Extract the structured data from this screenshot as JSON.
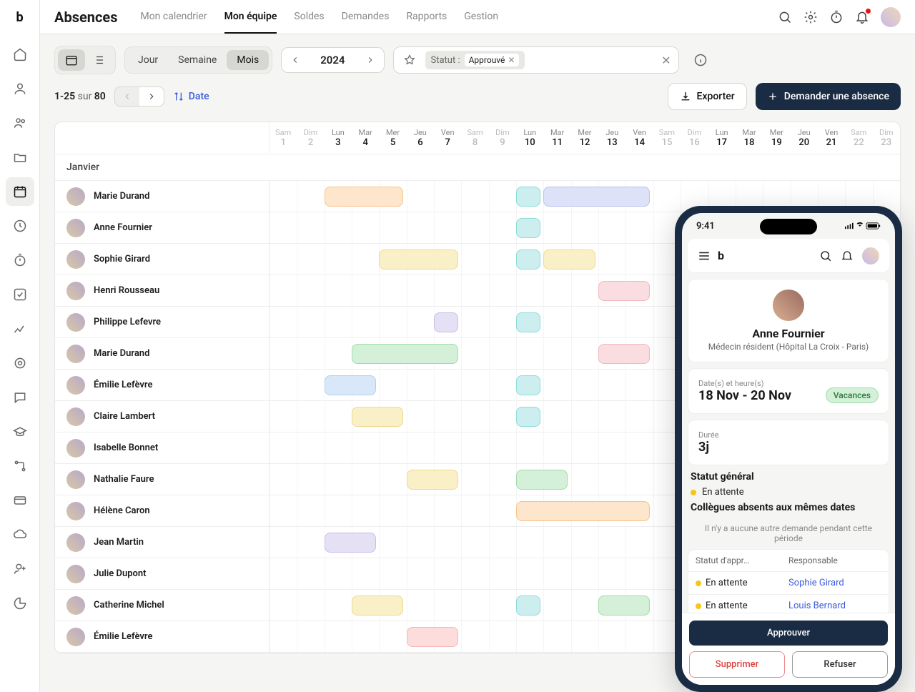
{
  "header": {
    "title": "Absences",
    "tabs": [
      "Mon calendrier",
      "Mon équipe",
      "Soldes",
      "Demandes",
      "Rapports",
      "Gestion"
    ],
    "active_tab": 1
  },
  "toolbar": {
    "view_modes": [
      "Jour",
      "Semaine",
      "Mois"
    ],
    "active_view": 2,
    "year": "2024",
    "filter_label": "Statut :",
    "filter_value": "Approuvé"
  },
  "subbar": {
    "range_from": "1-25",
    "range_of": "sur",
    "range_total": "80",
    "sort_label": "Date",
    "export_label": "Exporter",
    "request_label": "Demander une absence"
  },
  "calendar": {
    "month_label": "Janvier",
    "days": [
      {
        "dow": "Sam",
        "num": "1",
        "weekend": true
      },
      {
        "dow": "Dim",
        "num": "2",
        "weekend": true
      },
      {
        "dow": "Lun",
        "num": "3"
      },
      {
        "dow": "Mar",
        "num": "4"
      },
      {
        "dow": "Mer",
        "num": "5"
      },
      {
        "dow": "Jeu",
        "num": "6"
      },
      {
        "dow": "Ven",
        "num": "7"
      },
      {
        "dow": "Sam",
        "num": "8",
        "weekend": true
      },
      {
        "dow": "Dim",
        "num": "9",
        "weekend": true
      },
      {
        "dow": "Lun",
        "num": "10"
      },
      {
        "dow": "Mar",
        "num": "11"
      },
      {
        "dow": "Mer",
        "num": "12"
      },
      {
        "dow": "Jeu",
        "num": "13"
      },
      {
        "dow": "Ven",
        "num": "14"
      },
      {
        "dow": "Sam",
        "num": "15",
        "weekend": true
      },
      {
        "dow": "Dim",
        "num": "16",
        "weekend": true
      },
      {
        "dow": "Lun",
        "num": "17"
      },
      {
        "dow": "Mar",
        "num": "18"
      },
      {
        "dow": "Mer",
        "num": "19"
      },
      {
        "dow": "Jeu",
        "num": "20"
      },
      {
        "dow": "Ven",
        "num": "21"
      },
      {
        "dow": "Sam",
        "num": "22",
        "weekend": true
      },
      {
        "dow": "Dim",
        "num": "23",
        "weekend": true
      }
    ],
    "rows": [
      {
        "name": "Marie Durand",
        "bars": [
          {
            "start": 2,
            "span": 3,
            "color": "c-orange"
          },
          {
            "start": 9,
            "span": 1,
            "color": "c-teal"
          },
          {
            "start": 10,
            "span": 4,
            "color": "c-purple"
          }
        ]
      },
      {
        "name": "Anne Fournier",
        "bars": [
          {
            "start": 9,
            "span": 1,
            "color": "c-teal"
          }
        ]
      },
      {
        "name": "Sophie Girard",
        "bars": [
          {
            "start": 4,
            "span": 3,
            "color": "c-yellow"
          },
          {
            "start": 9,
            "span": 1,
            "color": "c-teal"
          },
          {
            "start": 10,
            "span": 2,
            "color": "c-yellow"
          }
        ]
      },
      {
        "name": "Henri Rousseau",
        "bars": [
          {
            "start": 12,
            "span": 2,
            "color": "c-pink"
          }
        ]
      },
      {
        "name": "Philippe Lefevre",
        "bars": [
          {
            "start": 6,
            "span": 1,
            "color": "c-lpurple"
          },
          {
            "start": 9,
            "span": 1,
            "color": "c-teal"
          }
        ]
      },
      {
        "name": "Marie Durand",
        "bars": [
          {
            "start": 3,
            "span": 4,
            "color": "c-green"
          },
          {
            "start": 12,
            "span": 2,
            "color": "c-pink"
          }
        ]
      },
      {
        "name": "Émilie Lefèvre",
        "bars": [
          {
            "start": 2,
            "span": 2,
            "color": "c-lblue"
          },
          {
            "start": 9,
            "span": 1,
            "color": "c-teal"
          }
        ]
      },
      {
        "name": "Claire Lambert",
        "bars": [
          {
            "start": 3,
            "span": 2,
            "color": "c-yellow"
          },
          {
            "start": 9,
            "span": 1,
            "color": "c-teal"
          }
        ]
      },
      {
        "name": "Isabelle Bonnet",
        "bars": []
      },
      {
        "name": "Nathalie Faure",
        "bars": [
          {
            "start": 5,
            "span": 2,
            "color": "c-yellow"
          },
          {
            "start": 9,
            "span": 2,
            "color": "c-green"
          }
        ]
      },
      {
        "name": "Hélène Caron",
        "bars": [
          {
            "start": 9,
            "span": 5,
            "color": "c-orange"
          }
        ]
      },
      {
        "name": "Jean Martin",
        "bars": [
          {
            "start": 2,
            "span": 2,
            "color": "c-lpurple"
          }
        ]
      },
      {
        "name": "Julie Dupont",
        "bars": []
      },
      {
        "name": "Catherine Michel",
        "bars": [
          {
            "start": 3,
            "span": 2,
            "color": "c-yellow"
          },
          {
            "start": 9,
            "span": 1,
            "color": "c-teal"
          },
          {
            "start": 12,
            "span": 2,
            "color": "c-green"
          }
        ]
      },
      {
        "name": "Émilie Lefèvre",
        "bars": [
          {
            "start": 5,
            "span": 2,
            "color": "c-red"
          }
        ]
      }
    ]
  },
  "phone": {
    "time": "9:41",
    "profile_name": "Anne Fournier",
    "profile_role": "Médecin résident (Hôpital La Croix - Paris)",
    "dates_label": "Date(s) et heure(s)",
    "dates_value": "18 Nov - 20 Nov",
    "badge": "Vacances",
    "duration_label": "Durée",
    "duration_value": "3j",
    "gen_status_label": "Statut général",
    "gen_status_value": "En attente",
    "colleagues_label": "Collègues absents aux mêmes dates",
    "colleagues_empty": "Il n'y a aucune autre demande pendant cette période",
    "approval_col1": "Statut d'appr…",
    "approval_col2": "Responsable",
    "approvals": [
      {
        "status": "En attente",
        "manager": "Sophie Girard"
      },
      {
        "status": "En attente",
        "manager": "Louis Bernard"
      }
    ],
    "approve_btn": "Approuver",
    "delete_btn": "Supprimer",
    "refuse_btn": "Refuser"
  }
}
